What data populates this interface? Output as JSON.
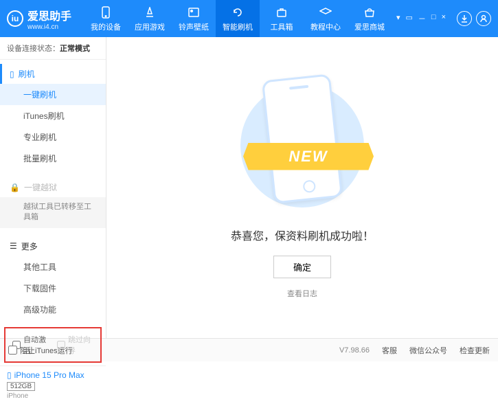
{
  "logo": {
    "initial": "iu",
    "text": "爱思助手",
    "sub": "www.i4.cn"
  },
  "nav": {
    "items": [
      {
        "label": "我的设备"
      },
      {
        "label": "应用游戏"
      },
      {
        "label": "铃声壁纸"
      },
      {
        "label": "智能刷机"
      },
      {
        "label": "工具箱"
      },
      {
        "label": "教程中心"
      },
      {
        "label": "爱思商城"
      }
    ]
  },
  "status": {
    "label": "设备连接状态：",
    "value": "正常模式"
  },
  "sidebar": {
    "flash_head": "刷机",
    "flash_items": [
      "一键刷机",
      "iTunes刷机",
      "专业刷机",
      "批量刷机"
    ],
    "jailbreak_head": "一键越狱",
    "jailbreak_note": "越狱工具已转移至工具箱",
    "more_head": "更多",
    "more_items": [
      "其他工具",
      "下载固件",
      "高级功能"
    ],
    "checks": {
      "auto_activate": "自动激活",
      "skip_guide": "跳过向导"
    }
  },
  "device": {
    "name": "iPhone 15 Pro Max",
    "storage": "512GB",
    "type": "iPhone"
  },
  "main": {
    "ribbon": "NEW",
    "success": "恭喜您，保资料刷机成功啦！",
    "ok": "确定",
    "log": "查看日志"
  },
  "footer": {
    "block": "阻止iTunes运行",
    "version": "V7.98.66",
    "links": [
      "客服",
      "微信公众号",
      "检查更新"
    ]
  }
}
